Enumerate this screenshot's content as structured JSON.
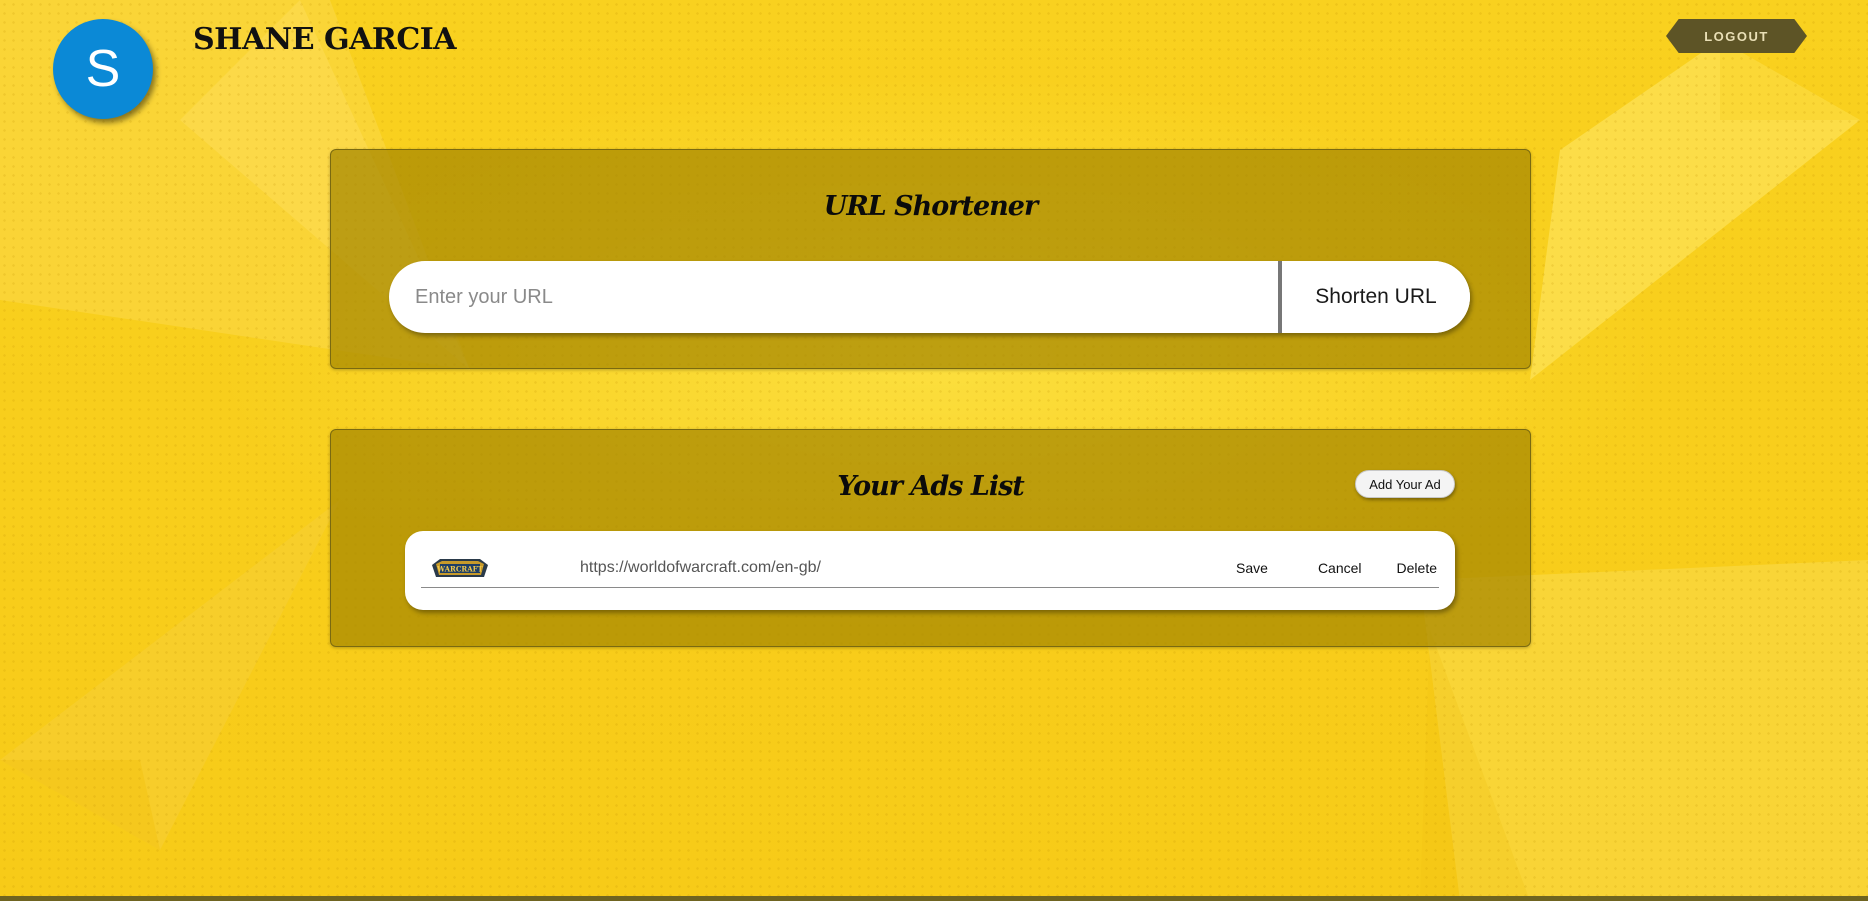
{
  "header": {
    "avatar_letter": "S",
    "username": "SHANE GARCIA",
    "logout_label": "LOGOUT"
  },
  "shortener": {
    "title": "URL Shortener",
    "input_placeholder": "Enter your URL",
    "input_value": "",
    "button_label": "Shorten URL"
  },
  "ads": {
    "title": "Your Ads List",
    "add_button_label": "Add Your Ad",
    "items": [
      {
        "logo_name": "warcraft-logo",
        "logo_text": "WARCRAFT",
        "url": "https://worldofwarcraft.com/en-gb/",
        "save_label": "Save",
        "cancel_label": "Cancel",
        "delete_label": "Delete"
      }
    ]
  },
  "colors": {
    "background": "#f8cf1c",
    "panel": "#a58700",
    "avatar": "#0b89d6",
    "logout": "#5d5426"
  }
}
